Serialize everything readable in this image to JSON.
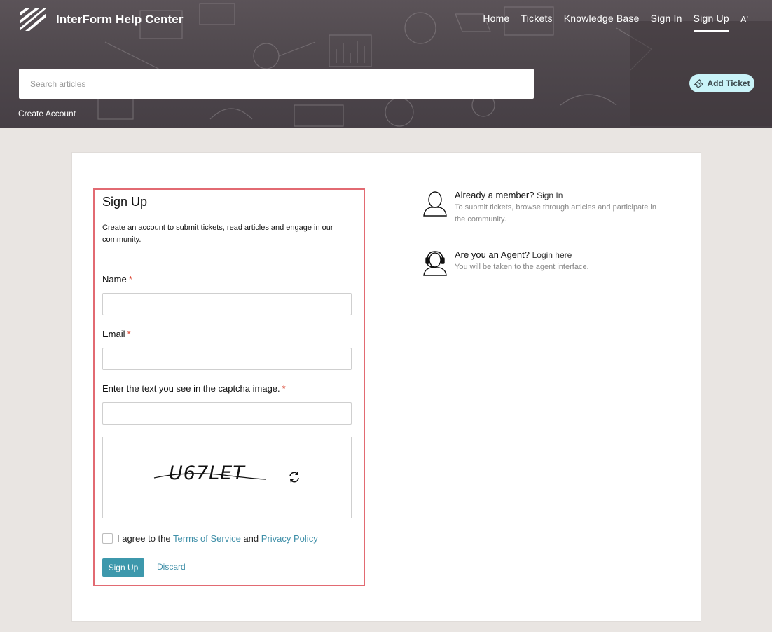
{
  "header": {
    "brand_name": "InterForm Help Center",
    "nav": {
      "home": "Home",
      "tickets": "Tickets",
      "knowledge_base": "Knowledge Base",
      "sign_in": "Sign In",
      "sign_up": "Sign Up",
      "font_size": "A'"
    },
    "search_placeholder": "Search articles",
    "add_ticket_label": "Add Ticket",
    "breadcrumb": "Create Account"
  },
  "form": {
    "title": "Sign Up",
    "description": "Create an account to submit tickets, read articles and engage in our community.",
    "name_label": "Name",
    "email_label": "Email",
    "captcha_label": "Enter the text you see in the captcha image.",
    "required_mark": "*",
    "captcha_text": "U67LET",
    "agree_prefix": "I agree to the",
    "terms_link": "Terms of Service",
    "agree_and": "and",
    "privacy_link": "Privacy Policy",
    "submit_label": "Sign Up",
    "discard_label": "Discard"
  },
  "side": {
    "member_question": "Already a member?",
    "member_link": "Sign In",
    "member_desc": "To submit tickets, browse through articles and participate in the community.",
    "agent_question": "Are you an Agent?",
    "agent_link": "Login here",
    "agent_desc": "You will be taken to the agent interface."
  },
  "colors": {
    "accent": "#3d98ac",
    "highlight_border": "#e26a72",
    "required": "#d9432f",
    "add_ticket_bg": "#c9f3f8"
  }
}
